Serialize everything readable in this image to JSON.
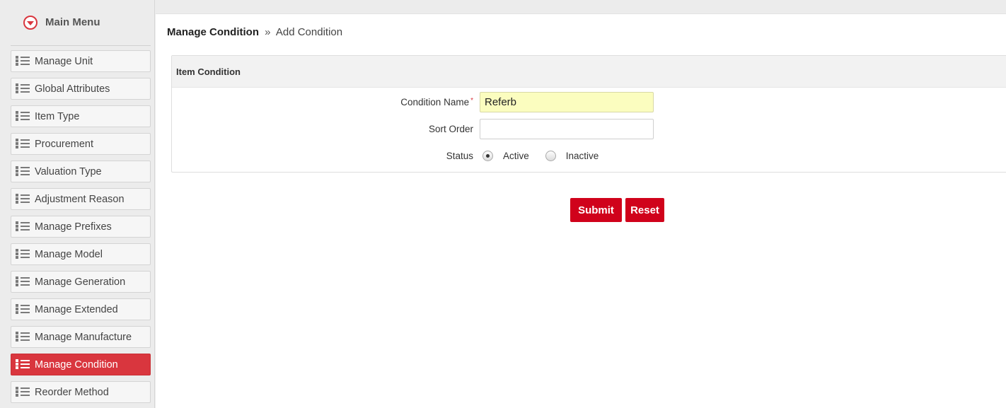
{
  "sidebar": {
    "title": "Main Menu",
    "items": [
      {
        "label": "Manage Unit",
        "active": false
      },
      {
        "label": "Global Attributes",
        "active": false
      },
      {
        "label": "Item Type",
        "active": false
      },
      {
        "label": "Procurement",
        "active": false
      },
      {
        "label": "Valuation Type",
        "active": false
      },
      {
        "label": "Adjustment Reason",
        "active": false
      },
      {
        "label": "Manage Prefixes",
        "active": false
      },
      {
        "label": "Manage Model",
        "active": false
      },
      {
        "label": "Manage Generation",
        "active": false
      },
      {
        "label": "Manage Extended",
        "active": false
      },
      {
        "label": "Manage Manufacture",
        "active": false
      },
      {
        "label": "Manage Condition",
        "active": true
      },
      {
        "label": "Reorder Method",
        "active": false
      }
    ]
  },
  "breadcrumb": {
    "section": "Manage Condition",
    "separator": "»",
    "page": "Add Condition"
  },
  "panel": {
    "title": "Item Condition"
  },
  "form": {
    "condition_name": {
      "label": "Condition Name",
      "required_mark": "*",
      "value": "Referb",
      "placeholder": ""
    },
    "sort_order": {
      "label": "Sort Order",
      "value": "",
      "placeholder": ""
    },
    "status": {
      "label": "Status",
      "options": [
        "Active",
        "Inactive"
      ],
      "selected": "Active"
    }
  },
  "buttons": {
    "submit": "Submit",
    "reset": "Reset"
  },
  "colors": {
    "accent": "#d9363e",
    "button": "#d0021b",
    "focused_input": "#fbfdbf"
  },
  "icons": {
    "menu_toggle": "chevron-down-circle-icon",
    "menu_item": "list-icon"
  }
}
